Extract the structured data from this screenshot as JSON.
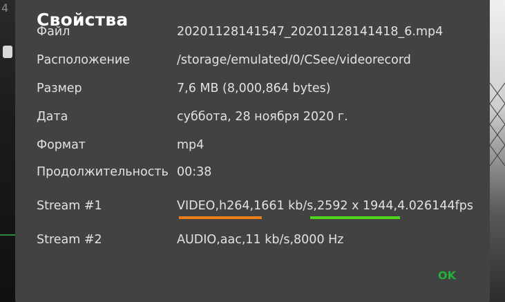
{
  "background": {
    "left_fragment": "4",
    "right_description": "camera preview behind dialog"
  },
  "dialog": {
    "title": "Свойства",
    "rows": [
      {
        "label": "Файл",
        "value": "20201128141547_20201128141418_6.mp4"
      },
      {
        "label": "Расположение",
        "value": "/storage/emulated/0/CSee/videorecord"
      },
      {
        "label": "Размер",
        "value": "7,6 MB (8,000,864 bytes)"
      },
      {
        "label": "Дата",
        "value": "суббота, 28 ноября 2020 г."
      },
      {
        "label": "Формат",
        "value": "mp4"
      },
      {
        "label": "Продолжительность",
        "value": "00:38"
      },
      {
        "label": "Stream #1",
        "value": "VIDEO,h264,1661 kb/s,2592 x 1944,4.026144fps"
      },
      {
        "label": "Stream #2",
        "value": "AUDIO,aac,11 kb/s,8000 Hz"
      }
    ],
    "ok_label": "OK"
  },
  "colors": {
    "dialog_background": "#424242",
    "text": "#e2e2e2",
    "title": "#ffffff",
    "ok": "#1fb33a",
    "underline_codec": "#ef7d1a",
    "underline_resolution": "#4dd61c"
  }
}
